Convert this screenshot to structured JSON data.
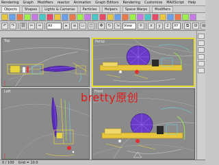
{
  "menubar": {
    "items": [
      "Rendering",
      "Graph",
      "Modifiers",
      "reactor",
      "Animation",
      "Graph Editors",
      "Rendering",
      "Customize",
      "MAXScript",
      "Help"
    ]
  },
  "command_tabs": {
    "items": [
      "Objects",
      "Shapes",
      "Lights & Cameras",
      "Particles",
      "Helpers",
      "Space Warps",
      "Modifiers"
    ],
    "active_index": 0
  },
  "shelf_icons": [
    "box-icon",
    "sphere-icon",
    "cylinder-icon",
    "torus-icon",
    "teapot-icon",
    "cone-icon",
    "geosphere-icon",
    "tube-icon",
    "pyramid-icon",
    "plane-icon",
    "light-icon",
    "camera-icon",
    "helper-icon",
    "spacewarp-icon",
    "dummy-icon",
    "point-icon",
    "grid-icon",
    "tape-icon",
    "protractor-icon",
    "compass-icon",
    "bone-icon",
    "link-icon",
    "particle-icon",
    "spray-icon",
    "snow-icon",
    "blizzard-icon"
  ],
  "toolbar": {
    "selection_filter": "All",
    "reference_coord": "View",
    "axis_constraint": "XY"
  },
  "viewports": {
    "top_label": "Top",
    "perspective_label": "Persp",
    "left_label": "Left",
    "front_label": "Front"
  },
  "watermark": "bretty原创",
  "status": {
    "frame": "0 / 100",
    "grid": "Grid = 10.0"
  },
  "colors": {
    "active_border": "#e6dc2a",
    "viewport_bg": "#8b8b8b",
    "watermark": "#e01818",
    "wire_yellow": "#e8d640",
    "wire_purple": "#5a2ab8",
    "wire_cyan": "#6ad8e8",
    "wire_green": "#9ef04a"
  }
}
